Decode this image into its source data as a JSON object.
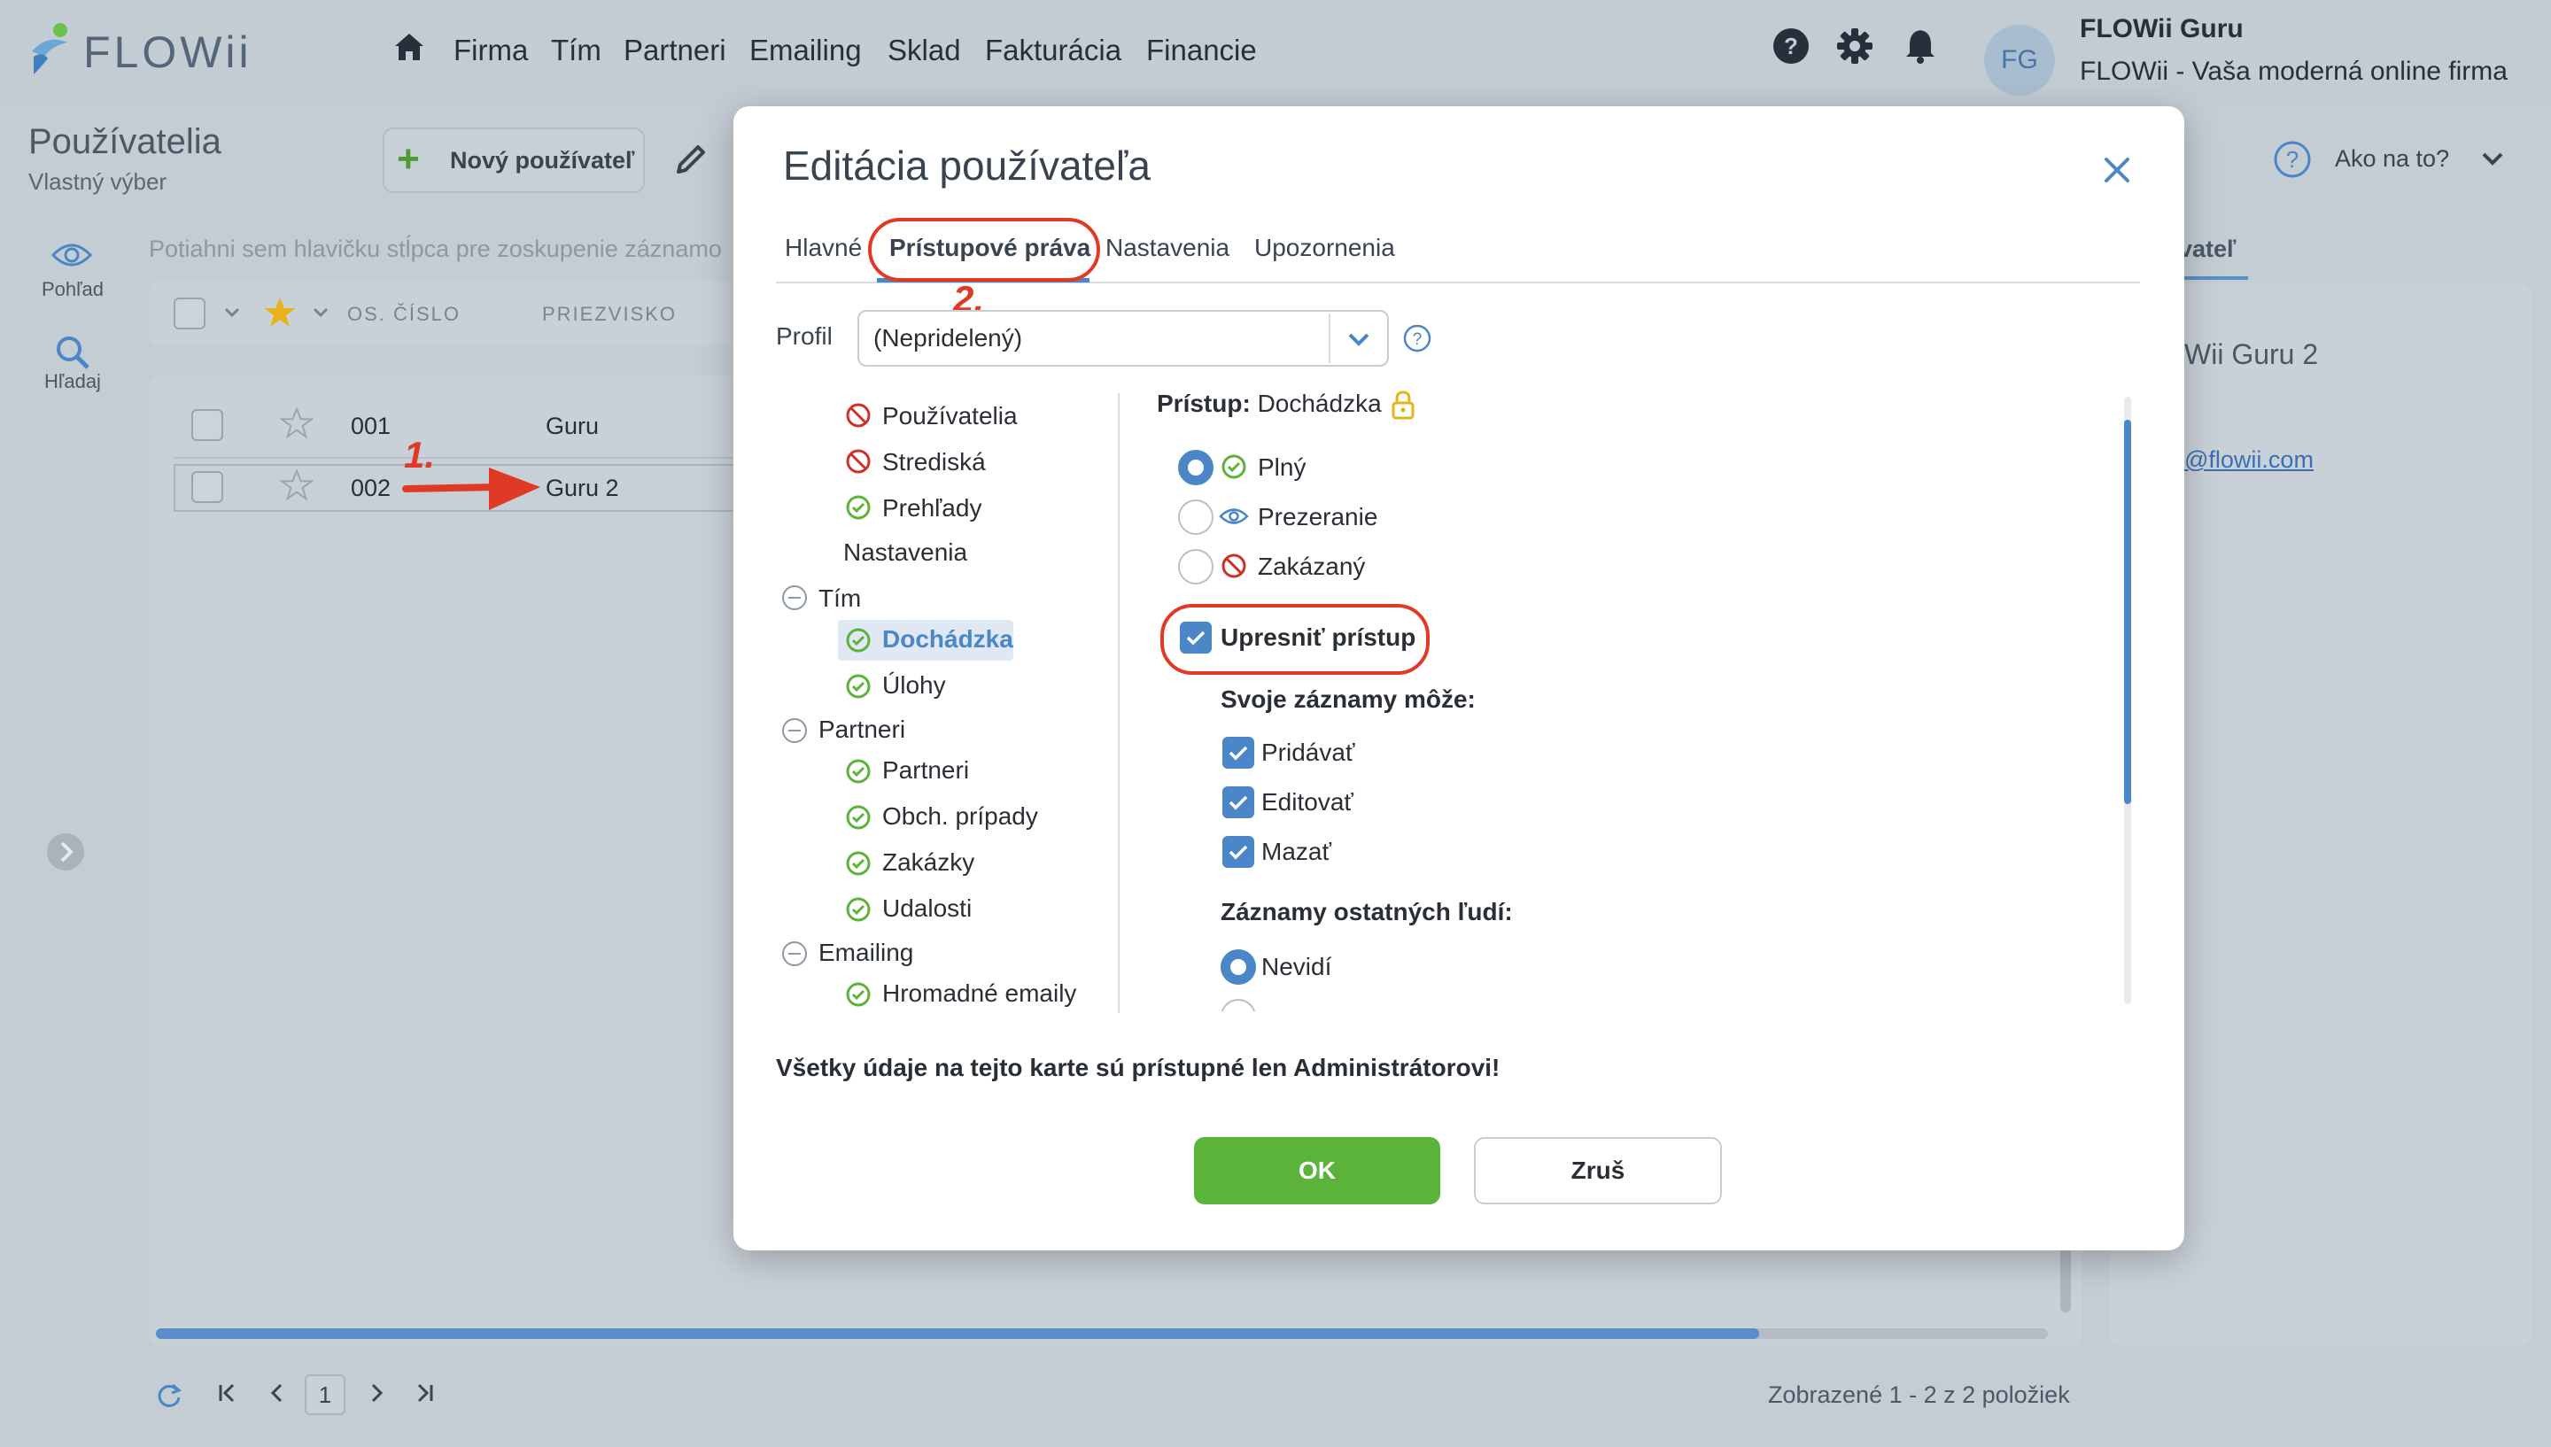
{
  "app": {
    "logo_text": "FLOWii"
  },
  "nav": [
    "Firma",
    "Tím",
    "Partneri",
    "Emailing",
    "Sklad",
    "Fakturácia",
    "Financie"
  ],
  "user": {
    "initials": "FG",
    "name": "FLOWii Guru",
    "company": "FLOWii - Vaša moderná online firma"
  },
  "page": {
    "title": "Používatelia",
    "subtitle": "Vlastný výber",
    "new_button": "Nový používateľ",
    "howto": "Ako na to?"
  },
  "rail": {
    "view": "Pohľad",
    "search": "Hľadaj"
  },
  "list": {
    "group_hint": "Potiahni sem hlavičku stĺpca pre zoskupenie záznamo",
    "columns": [
      "OS. ČÍSLO",
      "PRIEZVISKO"
    ],
    "rows": [
      {
        "num": "001",
        "surname": "Guru"
      },
      {
        "num": "002",
        "surname": "Guru 2"
      }
    ],
    "pager": {
      "page": "1",
      "summary": "Zobrazené 1 - 2 z 2 položiek"
    }
  },
  "right": {
    "tab": "vateľ",
    "name": "Wii Guru 2",
    "email": "@flowii.com"
  },
  "annotations": {
    "step1": "1.",
    "step2": "2."
  },
  "dialog": {
    "title": "Editácia používateľa",
    "tabs": [
      "Hlavné",
      "Prístupové práva",
      "Nastavenia",
      "Upozornenia"
    ],
    "profile_label": "Profil",
    "profile_value": "(Nepridelený)",
    "tree": [
      {
        "label": "Používatelia",
        "state": "denied"
      },
      {
        "label": "Strediská",
        "state": "denied"
      },
      {
        "label": "Prehľady",
        "state": "full"
      },
      {
        "label": "Nastavenia",
        "state": "none"
      },
      {
        "label": "Tím",
        "state": "group"
      },
      {
        "label": "Dochádzka",
        "state": "full"
      },
      {
        "label": "Úlohy",
        "state": "full"
      },
      {
        "label": "Partneri",
        "state": "group"
      },
      {
        "label": "Partneri",
        "state": "full"
      },
      {
        "label": "Obch. prípady",
        "state": "full"
      },
      {
        "label": "Zakázky",
        "state": "full"
      },
      {
        "label": "Udalosti",
        "state": "full"
      },
      {
        "label": "Emailing",
        "state": "group"
      },
      {
        "label": "Hromadné emaily",
        "state": "full"
      }
    ],
    "access_label": "Prístup:",
    "access_module": "Dochádzka",
    "access_options": [
      "Plný",
      "Prezeranie",
      "Zakázaný"
    ],
    "refine_label": "Upresniť prístup",
    "own_records_label": "Svoje záznamy môže:",
    "own_options": [
      "Pridávať",
      "Editovať",
      "Mazať"
    ],
    "others_label": "Záznamy ostatných ľudí:",
    "others_options": [
      "Nevidí"
    ],
    "footnote": "Všetky údaje na tejto karte sú prístupné len Administrátorovi!",
    "ok": "OK",
    "cancel": "Zruš"
  },
  "colors": {
    "accent": "#4a86c8",
    "ok": "#5cb33a",
    "annotation": "#e03a27",
    "denied": "#d0302a",
    "allowed": "#5cb33a"
  }
}
